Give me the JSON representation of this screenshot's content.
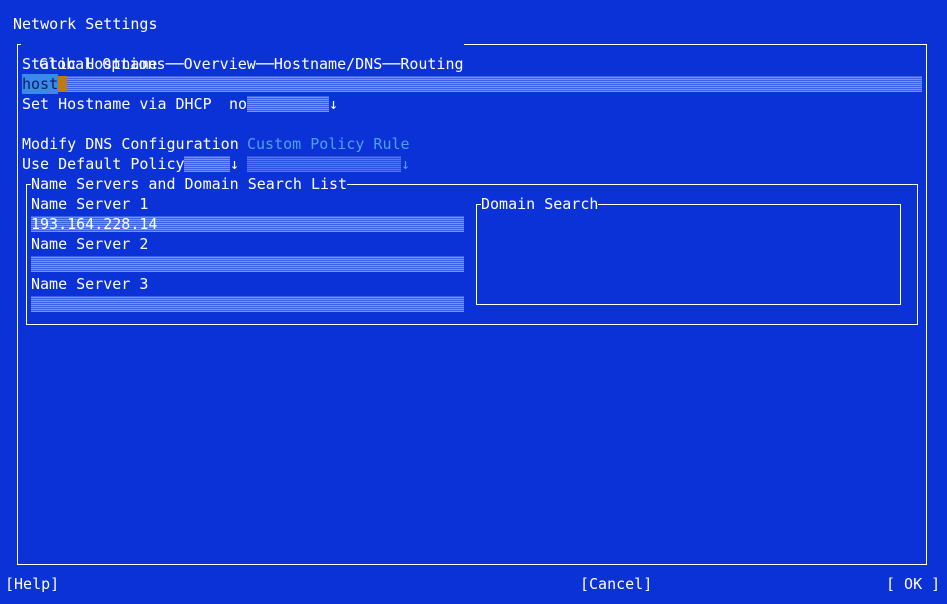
{
  "window": {
    "title": "Network Settings"
  },
  "tabs": [
    {
      "label": "Global Options"
    },
    {
      "label": "Overview"
    },
    {
      "label": "Hostname/DNS"
    },
    {
      "label": "Routing"
    }
  ],
  "hostname": {
    "label": "Static Hostname",
    "value": "host"
  },
  "dhcp_hostname": {
    "label": "Set Hostname via DHCP",
    "value": "no"
  },
  "dns": {
    "modify_label": "Modify DNS Configuration",
    "custom_policy_label": "Custom Policy Rule",
    "policy_value": "Use Default Policy"
  },
  "nameservers_frame": {
    "title": "Name Servers and Domain Search List",
    "ns1_label": "Name Server 1",
    "ns1_value": "193.164.228.14",
    "ns2_label": "Name Server 2",
    "ns2_value": "",
    "ns3_label": "Name Server 3",
    "ns3_value": "",
    "domain_search_label": "Domain Search"
  },
  "buttons": {
    "help": "[Help]",
    "cancel": "[Cancel]",
    "ok": "[ OK ]"
  },
  "icons": {
    "dropdown": "down-arrow"
  },
  "colors": {
    "background": "#0a32d6",
    "field": "#3a60e6",
    "cursor": "#c07a10",
    "muted_text": "#4fa0f0"
  }
}
